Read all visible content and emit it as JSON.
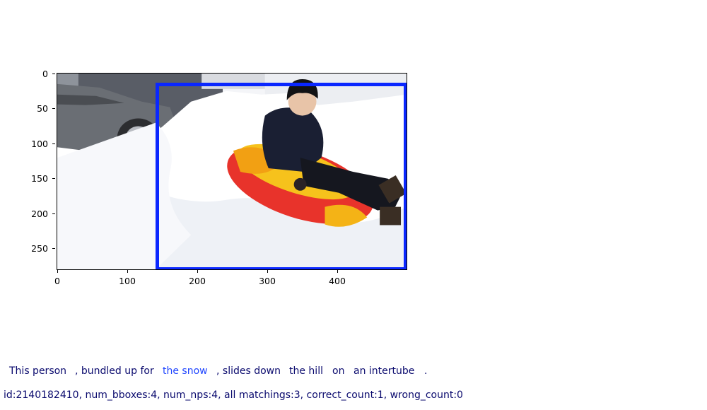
{
  "figure": {
    "y_ticks": [
      "0",
      "50",
      "100",
      "150",
      "200",
      "250"
    ],
    "x_ticks": [
      "0",
      "100",
      "200",
      "300",
      "400"
    ],
    "bbox_color": "#0a27ff"
  },
  "caption": {
    "phrases": [
      {
        "text": "This person",
        "color": "#0a0a6e"
      },
      {
        "text": ", bundled up for",
        "color": "#0a0a6e"
      },
      {
        "text": "the snow",
        "color": "#1f45ff"
      },
      {
        "text": ", slides down",
        "color": "#0a0a6e"
      },
      {
        "text": "the hill",
        "color": "#0a0a6e"
      },
      {
        "text": "on",
        "color": "#0a0a6e"
      },
      {
        "text": "an intertube",
        "color": "#0a0a6e"
      },
      {
        "text": ".",
        "color": "#0a0a6e"
      }
    ]
  },
  "meta": {
    "line": "id:2140182410, num_bboxes:4, num_nps:4, all matchings:3, correct_count:1, wrong_count:0"
  }
}
